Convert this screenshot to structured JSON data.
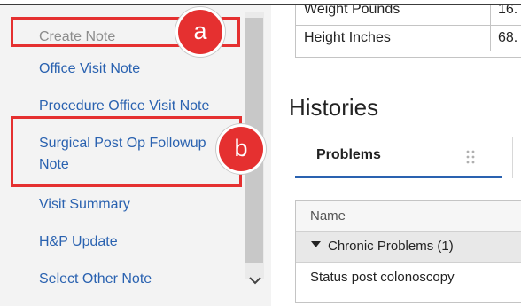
{
  "menu": {
    "items": [
      {
        "label": "Create Note"
      },
      {
        "label": "Office Visit Note"
      },
      {
        "label": "Procedure Office Visit Note"
      },
      {
        "label": "Surgical Post Op Followup Note"
      },
      {
        "label": "Visit Summary"
      },
      {
        "label": "H&P Update"
      },
      {
        "label": "Select Other Note"
      }
    ],
    "scroll_down_icon": "chevron-down-icon"
  },
  "annotations": {
    "a": "a",
    "b": "b",
    "color": "#e53030"
  },
  "vitals": {
    "rows": [
      {
        "label": "Weight Pounds",
        "value": "16."
      },
      {
        "label": "Height Inches",
        "value": "68."
      }
    ]
  },
  "histories": {
    "title": "Histories",
    "active_tab": "Problems",
    "grip_icon": "drag-handle-icon",
    "grid": {
      "column_header": "Name",
      "group": "Chronic Problems (1)",
      "group_icon": "caret-down-icon",
      "rows": [
        "Status post colonoscopy"
      ]
    }
  },
  "colors": {
    "link": "#2a62b0",
    "disabled": "#8c8c8c",
    "annotation": "#e53030",
    "panel": "#f3f3f3"
  }
}
